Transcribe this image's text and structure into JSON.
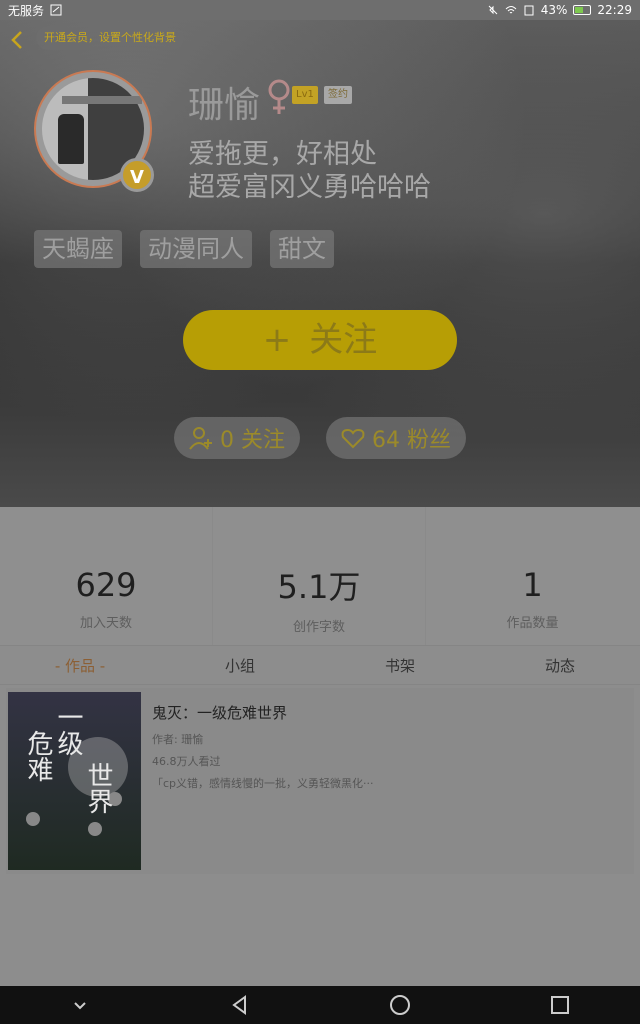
{
  "status_bar": {
    "carrier": "无服务",
    "battery": "43%",
    "time": "22:29"
  },
  "header": {
    "vip_prompt": "开通会员，设置个性化背景",
    "username": "珊愉",
    "level": "Lv1",
    "sign_badge": "签约",
    "bio_line1": "爱拖更，好相处",
    "bio_line2": "超爱富冈义勇哈哈哈",
    "tags": [
      "天蝎座",
      "动漫同人",
      "甜文"
    ],
    "follow_button": "关注",
    "follow_count": "0 关注",
    "fans_count": "64 粉丝"
  },
  "stats": [
    {
      "value": "629",
      "label": "加入天数"
    },
    {
      "value": "5.1万",
      "label": "创作字数"
    },
    {
      "value": "1",
      "label": "作品数量"
    }
  ],
  "tabs": [
    "- 作品 -",
    "小组",
    "书架",
    "动态"
  ],
  "works": [
    {
      "title": "鬼灭：一级危难世界",
      "author": "作者: 珊愉",
      "views": "46.8万人看过",
      "excerpt": "「cp义错，感情线慢的一批，义勇轻微黑化···",
      "cover_text": [
        "一级",
        "危难",
        "世界"
      ]
    }
  ],
  "colors": {
    "accent_yellow": "#b79e05",
    "active_tab": "#8c5f34"
  }
}
